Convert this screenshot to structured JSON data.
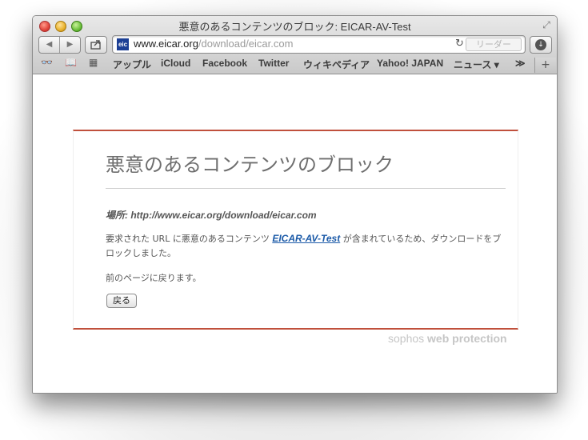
{
  "window": {
    "title": "悪意のあるコンテンツのブロック: EICAR-AV-Test"
  },
  "toolbar": {
    "back_icon": "◀",
    "forward_icon": "▶",
    "url_host": "www.eicar.org",
    "url_path": "/download/eicar.com",
    "favicon_text": "eic",
    "reader_label": "リーダー"
  },
  "bookmarks": {
    "items": [
      "アップル",
      "iCloud",
      "Facebook",
      "Twitter",
      "ウィキペディア",
      "Yahoo! JAPAN",
      "ニュース ▾"
    ],
    "more": "≫"
  },
  "page": {
    "heading": "悪意のあるコンテンツのブロック",
    "location": "場所: http://www.eicar.org/download/eicar.com",
    "message_pre": "要求された URL に悪意のあるコンテンツ ",
    "threat_name": "EICAR-AV-Test",
    "message_post": " が含まれているため、ダウンロードをブロックしました。",
    "back_text": "前のページに戻ります。",
    "back_button": "戻る",
    "brand_light": "sophos ",
    "brand_bold": "web protection"
  },
  "colors": {
    "accent_rule": "#c0503c",
    "link": "#1b5aa8"
  }
}
